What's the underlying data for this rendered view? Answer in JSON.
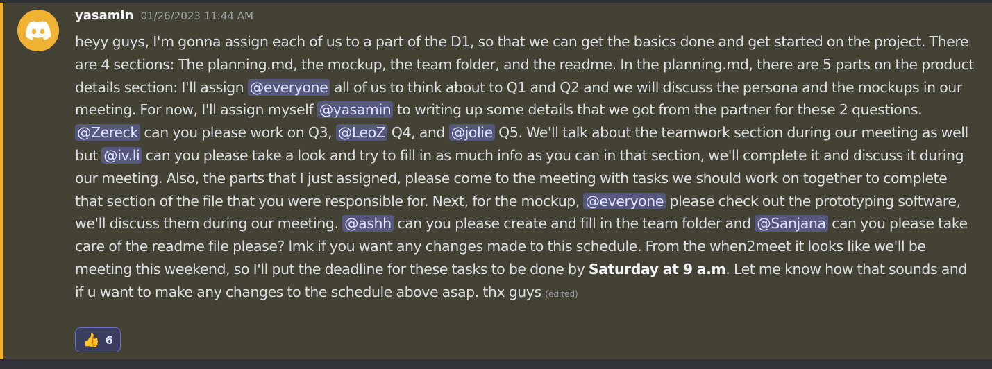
{
  "message": {
    "username": "yasamin",
    "timestamp": "01/26/2023 11:44 AM",
    "accent_color": "#f0b232",
    "avatar_icon": "discord-logo-icon",
    "segments": [
      {
        "type": "text",
        "text": "heyy guys, I'm gonna assign each of us to a part of the D1, so that we can get the basics done and get started on the project. There are 4 sections: The planning.md, the mockup, the team folder, and the readme. In the planning.md, there are 5 parts on the product details section: I'll assign "
      },
      {
        "type": "mention",
        "text": "@everyone"
      },
      {
        "type": "text",
        "text": " all of us to think about to Q1 and Q2 and we will discuss the persona and the mockups in our meeting. For now, I'll assign myself "
      },
      {
        "type": "mention",
        "text": "@yasamin"
      },
      {
        "type": "text",
        "text": " to writing up some details that we got from the partner for these 2 questions. "
      },
      {
        "type": "mention",
        "text": "@Zereck"
      },
      {
        "type": "text",
        "text": " can you please work on Q3, "
      },
      {
        "type": "mention",
        "text": "@LeoZ"
      },
      {
        "type": "text",
        "text": "  Q4, and "
      },
      {
        "type": "mention",
        "text": "@jolie"
      },
      {
        "type": "text",
        "text": "  Q5. We'll talk about the teamwork section during our meeting as well but "
      },
      {
        "type": "mention",
        "text": "@iv.li"
      },
      {
        "type": "text",
        "text": "  can you please take a look and try to fill in as much info as you can in that section, we'll complete it and discuss it during our meeting. Also, the parts that I just assigned, please come to the meeting with tasks we should work on together to complete that section of the file that you were responsible for. Next, for the mockup, "
      },
      {
        "type": "mention",
        "text": "@everyone"
      },
      {
        "type": "text",
        "text": "  please check out the prototyping software, we'll discuss them during our meeting. "
      },
      {
        "type": "mention",
        "text": "@ashh"
      },
      {
        "type": "text",
        "text": " can you please create and fill in the team folder and "
      },
      {
        "type": "mention",
        "text": "@Sanjana"
      },
      {
        "type": "text",
        "text": "  can you please take care of the readme file please? lmk if you want any changes made to this schedule. From the when2meet it looks like we'll be meeting this weekend, so I'll put the deadline for these tasks to be done by "
      },
      {
        "type": "bold",
        "text": "Saturday at 9 a.m"
      },
      {
        "type": "text",
        "text": ". Let me know how that sounds and if u want to make any changes to the schedule above asap. thx guys "
      },
      {
        "type": "edited",
        "text": "(edited)"
      }
    ],
    "reaction": {
      "emoji": "👍",
      "emoji_name": "thumbs-up-icon",
      "count": "6"
    }
  }
}
